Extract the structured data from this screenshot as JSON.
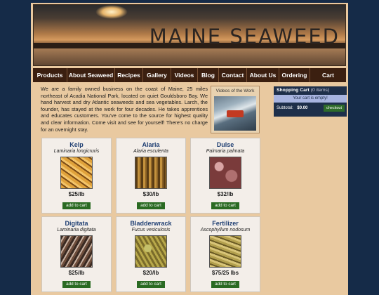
{
  "banner": {
    "title": "MAINE SEAWEED"
  },
  "nav": [
    "Products",
    "About Seaweed",
    "Recipes",
    "Gallery",
    "Videos",
    "Blog",
    "Contact",
    "About Us",
    "Ordering",
    "Cart"
  ],
  "intro": "We are a family owned business on the coast of Maine, 25 miles northeast of Acadia National Park, located on quiet Gouldsboro Bay. We hand harvest and dry Atlantic seaweeds and sea vegetables. Larch, the founder, has stayed at the work for four decades. He takes apprentices and educates customers. You've come to the source for highest quality and clear information. Come visit and see for yourself! There's no charge for an overnight stay.",
  "video": {
    "caption": "Videos of the Work"
  },
  "cart": {
    "title": "Shopping Cart",
    "count": "(0 items)",
    "empty": "Your cart is empty!",
    "subtotal_label": "Subtotal:",
    "subtotal": "$0.00",
    "checkout": "checkout"
  },
  "products": [
    {
      "name": "Kelp",
      "latin": "Laminaria longicruris",
      "price": "$25/lb",
      "button": "add to cart",
      "image": "kelp-photo"
    },
    {
      "name": "Alaria",
      "latin": "Alaria esculenta",
      "price": "$30/lb",
      "button": "add to cart",
      "image": "alaria-photo"
    },
    {
      "name": "Dulse",
      "latin": "Palmaria palmata",
      "price": "$32/lb",
      "button": "add to cart",
      "image": "dulse-photo"
    },
    {
      "name": "Digitata",
      "latin": "Laminaria digitata",
      "price": "$25/lb",
      "button": "add to cart",
      "image": "digitata-photo"
    },
    {
      "name": "Bladderwrack",
      "latin": "Fucus vesiculosis",
      "price": "$20/lb",
      "button": "add to cart",
      "image": "bladderwrack-photo"
    },
    {
      "name": "Fertilizer",
      "latin": "Ascophyllum nodosum",
      "price": "$75/25 lbs",
      "button": "add to cart",
      "image": "fertilizer-photo"
    }
  ]
}
